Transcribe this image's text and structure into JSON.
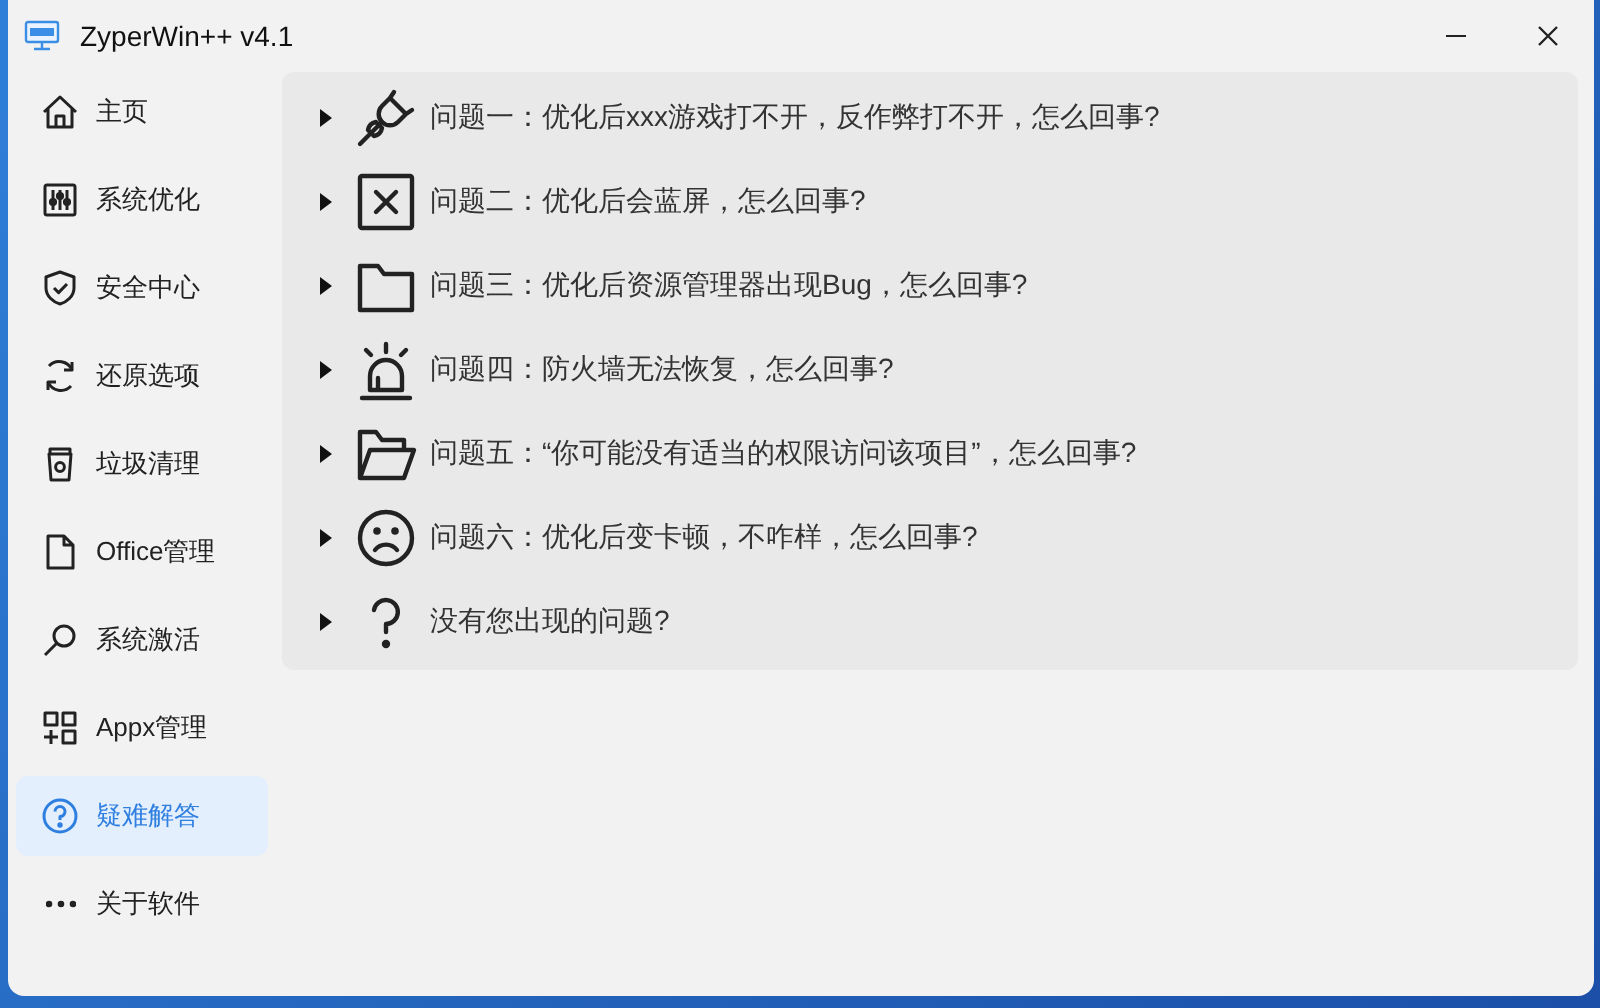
{
  "window": {
    "title": "ZyperWin++ v4.1"
  },
  "sidebar": {
    "items": [
      {
        "label": "主页",
        "selected": false
      },
      {
        "label": "系统优化",
        "selected": false
      },
      {
        "label": "安全中心",
        "selected": false
      },
      {
        "label": "还原选项",
        "selected": false
      },
      {
        "label": "垃圾清理",
        "selected": false
      },
      {
        "label": "Office管理",
        "selected": false
      },
      {
        "label": "系统激活",
        "selected": false
      },
      {
        "label": "Appx管理",
        "selected": false
      },
      {
        "label": "疑难解答",
        "selected": true
      },
      {
        "label": "关于软件",
        "selected": false
      }
    ]
  },
  "faq": {
    "items": [
      {
        "question": "问题一：优化后xxx游戏打不开，反作弊打不开，怎么回事?",
        "expanded": false
      },
      {
        "question": "问题二：优化后会蓝屏，怎么回事?",
        "expanded": false
      },
      {
        "question": "问题三：优化后资源管理器出现Bug，怎么回事?",
        "expanded": false
      },
      {
        "question": "问题四：防火墙无法恢复，怎么回事?",
        "expanded": false
      },
      {
        "question": "问题五：“你可能没有适当的权限访问该项目”，怎么回事?",
        "expanded": false
      },
      {
        "question": "问题六：优化后变卡顿，不咋样，怎么回事?",
        "expanded": false
      },
      {
        "question": "没有您出现的问题?",
        "expanded": false
      }
    ]
  }
}
